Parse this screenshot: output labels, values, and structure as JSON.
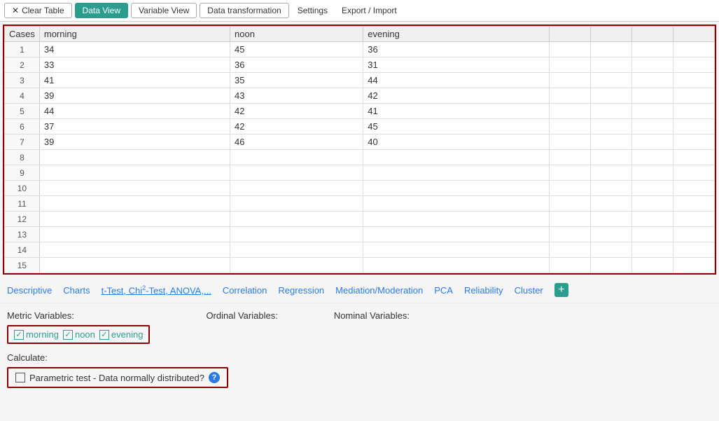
{
  "toolbar": {
    "clear_table_label": "Clear Table",
    "data_view_label": "Data View",
    "variable_view_label": "Variable View",
    "data_transformation_label": "Data transformation",
    "settings_label": "Settings",
    "export_import_label": "Export / Import"
  },
  "table": {
    "columns": [
      "Cases",
      "morning",
      "noon",
      "evening",
      "",
      "",
      "",
      ""
    ],
    "rows": [
      {
        "num": "1",
        "morning": "34",
        "noon": "45",
        "evening": "36",
        "c4": "",
        "c5": "",
        "c6": "",
        "c7": ""
      },
      {
        "num": "2",
        "morning": "33",
        "noon": "36",
        "evening": "31",
        "c4": "",
        "c5": "",
        "c6": "",
        "c7": ""
      },
      {
        "num": "3",
        "morning": "41",
        "noon": "35",
        "evening": "44",
        "c4": "",
        "c5": "",
        "c6": "",
        "c7": ""
      },
      {
        "num": "4",
        "morning": "39",
        "noon": "43",
        "evening": "42",
        "c4": "",
        "c5": "",
        "c6": "",
        "c7": ""
      },
      {
        "num": "5",
        "morning": "44",
        "noon": "42",
        "evening": "41",
        "c4": "",
        "c5": "",
        "c6": "",
        "c7": ""
      },
      {
        "num": "6",
        "morning": "37",
        "noon": "42",
        "evening": "45",
        "c4": "",
        "c5": "",
        "c6": "",
        "c7": ""
      },
      {
        "num": "7",
        "morning": "39",
        "noon": "46",
        "evening": "40",
        "c4": "",
        "c5": "",
        "c6": "",
        "c7": ""
      },
      {
        "num": "8",
        "morning": "",
        "noon": "",
        "evening": "",
        "c4": "",
        "c5": "",
        "c6": "",
        "c7": ""
      },
      {
        "num": "9",
        "morning": "",
        "noon": "",
        "evening": "",
        "c4": "",
        "c5": "",
        "c6": "",
        "c7": ""
      },
      {
        "num": "10",
        "morning": "",
        "noon": "",
        "evening": "",
        "c4": "",
        "c5": "",
        "c6": "",
        "c7": ""
      },
      {
        "num": "11",
        "morning": "",
        "noon": "",
        "evening": "",
        "c4": "",
        "c5": "",
        "c6": "",
        "c7": ""
      },
      {
        "num": "12",
        "morning": "",
        "noon": "",
        "evening": "",
        "c4": "",
        "c5": "",
        "c6": "",
        "c7": ""
      },
      {
        "num": "13",
        "morning": "",
        "noon": "",
        "evening": "",
        "c4": "",
        "c5": "",
        "c6": "",
        "c7": ""
      },
      {
        "num": "14",
        "morning": "",
        "noon": "",
        "evening": "",
        "c4": "",
        "c5": "",
        "c6": "",
        "c7": ""
      },
      {
        "num": "15",
        "morning": "",
        "noon": "",
        "evening": "",
        "c4": "",
        "c5": "",
        "c6": "",
        "c7": ""
      }
    ]
  },
  "analysis_nav": {
    "items": [
      {
        "label": "Descriptive",
        "underline": false
      },
      {
        "label": "Charts",
        "underline": false
      },
      {
        "label": "t-Test, Chi²-Test, ANOVA,...",
        "underline": true
      },
      {
        "label": "Correlation",
        "underline": false
      },
      {
        "label": "Regression",
        "underline": false
      },
      {
        "label": "Mediation/Moderation",
        "underline": false
      },
      {
        "label": "PCA",
        "underline": false
      },
      {
        "label": "Reliability",
        "underline": false
      },
      {
        "label": "Cluster",
        "underline": false
      }
    ]
  },
  "variables": {
    "metric_label": "Metric Variables:",
    "ordinal_label": "Ordinal Variables:",
    "nominal_label": "Nominal Variables:",
    "metric_vars": [
      "morning",
      "noon",
      "evening"
    ]
  },
  "calculate": {
    "title": "Calculate:",
    "parametric_label": "Parametric test - Data normally distributed?",
    "help_icon": "?"
  },
  "colors": {
    "accent": "#2a9d8f",
    "dark_red": "#8b0000",
    "link_blue": "#2a7ae2"
  }
}
